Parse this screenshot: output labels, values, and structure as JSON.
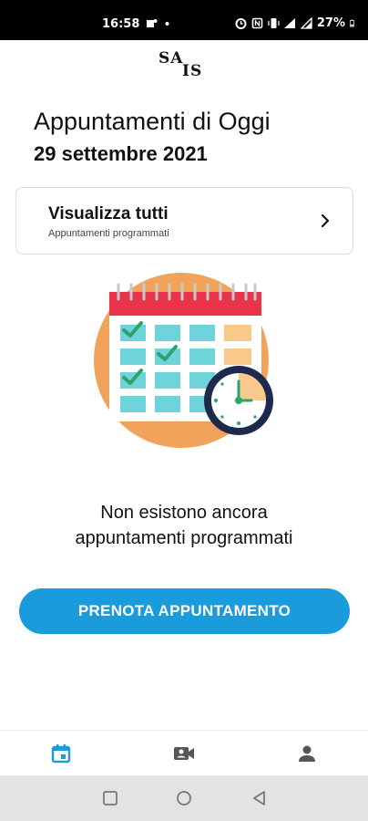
{
  "status_bar": {
    "time": "16:58",
    "battery": "27%",
    "icons": [
      "teams-icon",
      "dot-icon",
      "alarm-icon",
      "nfc-icon",
      "vibrate-icon",
      "wifi-icon",
      "signal-icon",
      "battery-icon"
    ]
  },
  "logo": {
    "line1": "SA",
    "line2": "IS"
  },
  "header": {
    "title": "Appuntamenti di Oggi",
    "date": "29 settembre 2021"
  },
  "card": {
    "title": "Visualizza tutti",
    "subtitle": "Appuntamenti programmati"
  },
  "empty_state": {
    "line1": "Non esistono ancora",
    "line2": "appuntamenti programmati"
  },
  "cta": {
    "label": "PRENOTA APPUNTAMENTO"
  },
  "bottom_nav": {
    "items": [
      {
        "icon": "calendar-icon",
        "active": true
      },
      {
        "icon": "video-icon",
        "active": false
      },
      {
        "icon": "person-icon",
        "active": false
      }
    ]
  },
  "colors": {
    "accent": "#1a9cdc",
    "status_bar": "#000000",
    "illustration_orange": "#f2a35b",
    "illustration_red": "#e8334a",
    "illustration_teal": "#6fd3dc",
    "illustration_green": "#2ea36c",
    "illustration_navy": "#1d2a4d"
  }
}
